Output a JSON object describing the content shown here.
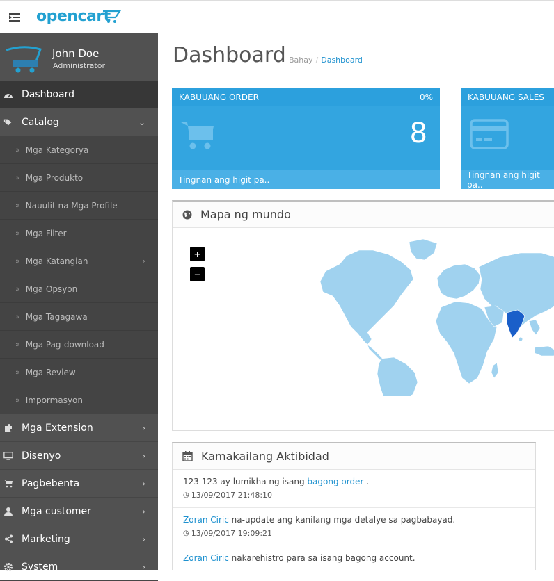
{
  "header": {
    "logo_text": "opencart",
    "menu_icon": "menu-toggle-icon"
  },
  "profile": {
    "name": "John Doe",
    "role": "Administrator"
  },
  "nav": {
    "dashboard": "Dashboard",
    "catalog": "Catalog",
    "catalog_items": [
      "Mga Kategorya",
      "Mga Produkto",
      "Nauulit na Mga Profile",
      "Mga Filter",
      "Mga Katangian",
      "Mga Opsyon",
      "Mga Tagagawa",
      "Mga Pag-download",
      "Mga Review",
      "Impormasyon"
    ],
    "extension": "Mga Extension",
    "disenyo": "Disenyo",
    "pagbebenta": "Pagbebenta",
    "customer": "Mga customer",
    "marketing": "Marketing",
    "system": "System"
  },
  "page": {
    "title": "Dashboard",
    "breadcrumb_home": "Bahay",
    "breadcrumb_current": "Dashboard"
  },
  "tiles": {
    "orders": {
      "title": "KABUUANG ORDER",
      "percent": "0%",
      "value": "8",
      "footer": "Tingnan ang higit pa.."
    },
    "sales": {
      "title": "KABUUANG SALES",
      "footer": "Tingnan ang higit pa.."
    }
  },
  "map": {
    "title": "Mapa ng mundo",
    "zoom_in": "+",
    "zoom_out": "−"
  },
  "activity": {
    "title": "Kamakailang Aktibidad",
    "items": [
      {
        "pre": "123 123 ay lumikha ng isang ",
        "link": "bagong order",
        "post": " .",
        "time": "13/09/2017 21:48:10"
      },
      {
        "pre": "",
        "link": "Zoran Ciric",
        "post": " na-update ang kanilang mga detalye sa pagbabayad.",
        "time": "13/09/2017 19:09:21"
      },
      {
        "pre": "",
        "link": "Zoran Ciric",
        "post": " nakarehistro para sa isang bagong account.",
        "time": ""
      }
    ]
  },
  "colors": {
    "primary": "#1e91cf",
    "sidebar": "#515151",
    "map_land": "#a0d2ef",
    "map_highlight": "#1a5fc9"
  }
}
